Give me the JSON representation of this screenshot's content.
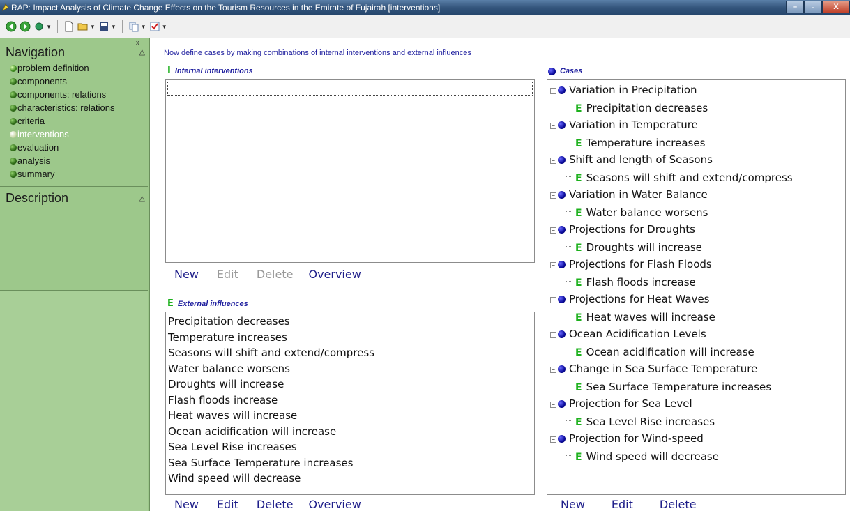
{
  "window": {
    "title": "RAP: Impact Analysis of Climate Change Effects on the Tourism Resources in the Emirate of Fujairah [interventions]",
    "controls": [
      "–",
      "▫",
      "X"
    ]
  },
  "toolbar": {
    "icons": [
      "back-icon",
      "forward-icon",
      "globe-icon",
      "new-document-icon",
      "open-folder-icon",
      "save-icon",
      "copy-icon",
      "checklist-icon"
    ]
  },
  "nav": {
    "title": "Navigation",
    "collapse_glyph": "△",
    "close_glyph": "x",
    "items": [
      {
        "label": "problem definition",
        "active": false
      },
      {
        "label": "components",
        "active": false
      },
      {
        "label": "components: relations",
        "active": false
      },
      {
        "label": "characteristics: relations",
        "active": false
      },
      {
        "label": "criteria",
        "active": false
      },
      {
        "label": "interventions",
        "active": true
      },
      {
        "label": "evaluation",
        "active": false
      },
      {
        "label": "analysis",
        "active": false
      },
      {
        "label": "summary",
        "active": false
      }
    ]
  },
  "description": {
    "title": "Description",
    "collapse_glyph": "△"
  },
  "main": {
    "intro": "Now define cases by making combinations of internal interventions and external influences",
    "internal": {
      "label": "Internal interventions",
      "icon_glyph": "I",
      "items": [],
      "buttons": {
        "new": "New",
        "edit": "Edit",
        "delete": "Delete",
        "overview": "Overview"
      }
    },
    "external": {
      "label": "External influences",
      "icon_glyph": "E",
      "items": [
        "Precipitation decreases",
        "Temperature increases",
        "Seasons will shift and extend/compress",
        "Water balance worsens",
        "Droughts will increase",
        "Flash floods increase",
        "Heat waves will increase",
        "Ocean acidification will increase",
        "Sea Level Rise increases",
        "Sea Surface Temperature increases",
        "Wind speed will decrease"
      ],
      "buttons": {
        "new": "New",
        "edit": "Edit",
        "delete": "Delete",
        "overview": "Overview"
      }
    },
    "cases": {
      "label": "Cases",
      "items": [
        {
          "name": "Variation in Precipitation",
          "child": "Precipitation decreases"
        },
        {
          "name": "Variation in Temperature",
          "child": "Temperature increases"
        },
        {
          "name": "Shift and length of Seasons",
          "child": "Seasons will shift and extend/compress"
        },
        {
          "name": "Variation in Water Balance",
          "child": "Water balance worsens"
        },
        {
          "name": "Projections for Droughts",
          "child": "Droughts will increase"
        },
        {
          "name": "Projections for Flash Floods",
          "child": "Flash floods increase"
        },
        {
          "name": "Projections for Heat Waves",
          "child": "Heat waves will increase"
        },
        {
          "name": "Ocean Acidification Levels",
          "child": "Ocean acidification will increase"
        },
        {
          "name": "Change in Sea Surface Temperature",
          "child": "Sea Surface Temperature increases"
        },
        {
          "name": "Projection for Sea Level",
          "child": "Sea Level Rise increases"
        },
        {
          "name": "Projection for Wind-speed",
          "child": "Wind speed will decrease"
        }
      ],
      "buttons": {
        "new": "New",
        "edit": "Edit",
        "delete": "Delete"
      }
    }
  },
  "colors": {
    "nav_bg": "#9dc88b",
    "link": "#1e1e8a",
    "disabled": "#9a9a9a",
    "label": "#1e1e9e",
    "external_icon": "#1cb01c",
    "case_icon": "#0a0a9a"
  }
}
